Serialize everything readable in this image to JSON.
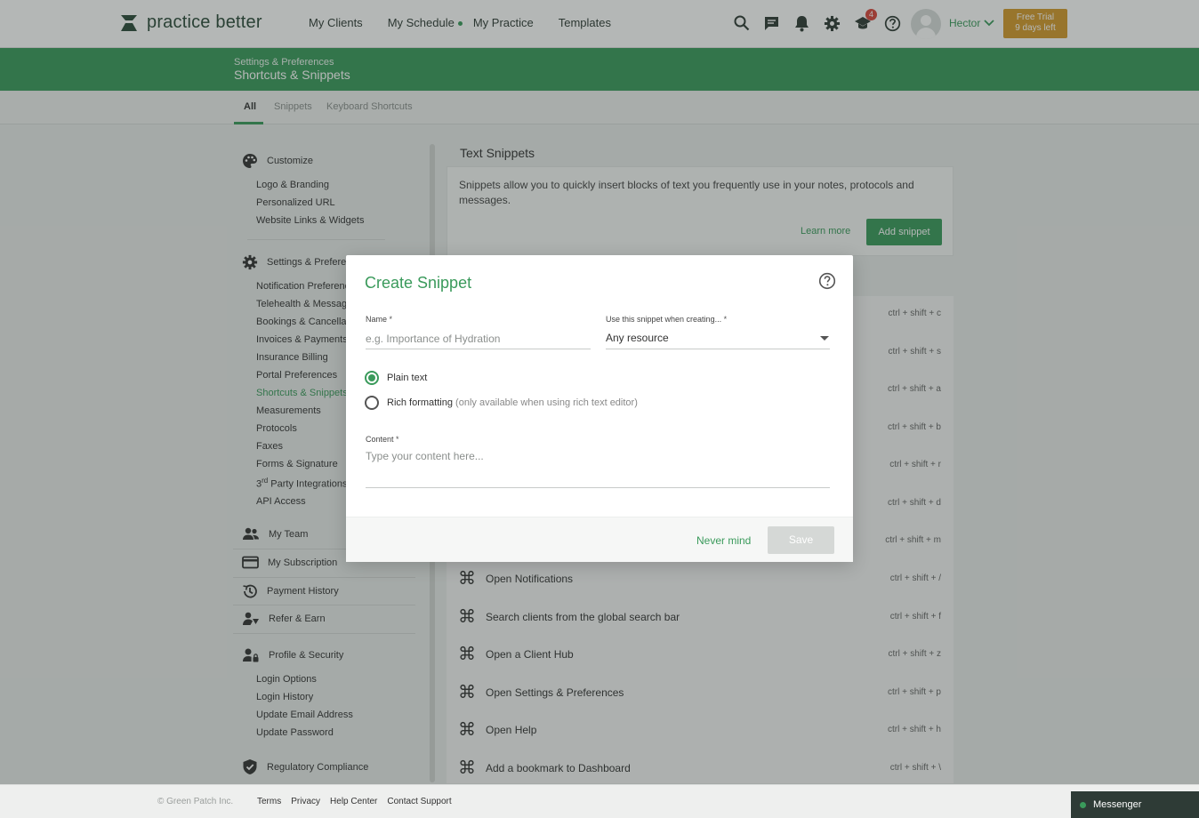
{
  "app": {
    "logo_text": "practice better"
  },
  "nav": [
    "My Clients",
    "My Schedule",
    "My Practice",
    "Templates"
  ],
  "topbar": {
    "notifications_count": "4",
    "user_name": "Hector",
    "trial_line1": "Free Trial",
    "trial_line2": "9 days left"
  },
  "header": {
    "breadcrumb": "Settings & Preferences",
    "title": "Shortcuts & Snippets"
  },
  "tabs": [
    "All",
    "Snippets",
    "Keyboard Shortcuts"
  ],
  "sidebar": {
    "customize": "Customize",
    "customize_links": [
      "Logo & Branding",
      "Personalized URL",
      "Website Links & Widgets"
    ],
    "settings": "Settings & Preferences",
    "settings_links": [
      "Notification Preferences",
      "Telehealth & Messaging",
      "Bookings & Cancellations",
      "Invoices & Payments",
      "Insurance Billing",
      "Portal Preferences",
      "Shortcuts & Snippets",
      "Measurements",
      "Protocols",
      "Faxes",
      "Forms & Signature"
    ],
    "third_party_sup": "rd",
    "third_party_pre": "3",
    "third_party_rest": " Party Integrations",
    "api": "API Access",
    "my_team": "My Team",
    "my_subscription": "My Subscription",
    "payment_history": "Payment History",
    "refer": "Refer & Earn",
    "profile": "Profile & Security",
    "profile_links": [
      "Login Options",
      "Login History",
      "Update Email Address",
      "Update Password"
    ],
    "compliance": "Regulatory Compliance"
  },
  "main": {
    "heading": "Text Snippets",
    "description": "Snippets allow you to quickly insert blocks of text you frequently use in your notes, protocols and messages.",
    "learn_more": "Learn more",
    "add_snippet": "Add snippet",
    "shortcuts": [
      {
        "label": "",
        "keys": "ctrl + shift + c"
      },
      {
        "label": "",
        "keys": "ctrl + shift + s"
      },
      {
        "label": "",
        "keys": "ctrl + shift + a"
      },
      {
        "label": "",
        "keys": "ctrl + shift + b"
      },
      {
        "label": "",
        "keys": "ctrl + shift + r"
      },
      {
        "label": "",
        "keys": "ctrl + shift + d"
      },
      {
        "label": "",
        "keys": "ctrl + shift + m"
      },
      {
        "label": "Open Notifications",
        "keys": "ctrl + shift + /"
      },
      {
        "label": "Search clients from the global search bar",
        "keys": "ctrl + shift + f"
      },
      {
        "label": "Open a Client Hub",
        "keys": "ctrl + shift + z"
      },
      {
        "label": "Open Settings & Preferences",
        "keys": "ctrl + shift + p"
      },
      {
        "label": "Open Help",
        "keys": "ctrl + shift + h"
      },
      {
        "label": "Add a bookmark to Dashboard",
        "keys": "ctrl + shift + \\"
      }
    ]
  },
  "modal": {
    "title": "Create Snippet",
    "name_label": "Name",
    "name_placeholder": "e.g. Importance of Hydration",
    "use_label": "Use this snippet when creating...",
    "use_value": "Any resource",
    "required_mark": "*",
    "plain_text": "Plain text",
    "rich_text": "Rich formatting",
    "rich_hint": "(only available when using rich text editor)",
    "content_label": "Content",
    "content_placeholder": "Type your content here...",
    "cancel": "Never mind",
    "save": "Save"
  },
  "footer": {
    "copyright": "© Green Patch Inc.",
    "links": [
      "Terms",
      "Privacy",
      "Help Center",
      "Contact Support"
    ],
    "messenger": "Messenger"
  },
  "colors": {
    "brand": "#3a9a5b",
    "trial": "#d59a2c",
    "badge": "#d9453b"
  }
}
